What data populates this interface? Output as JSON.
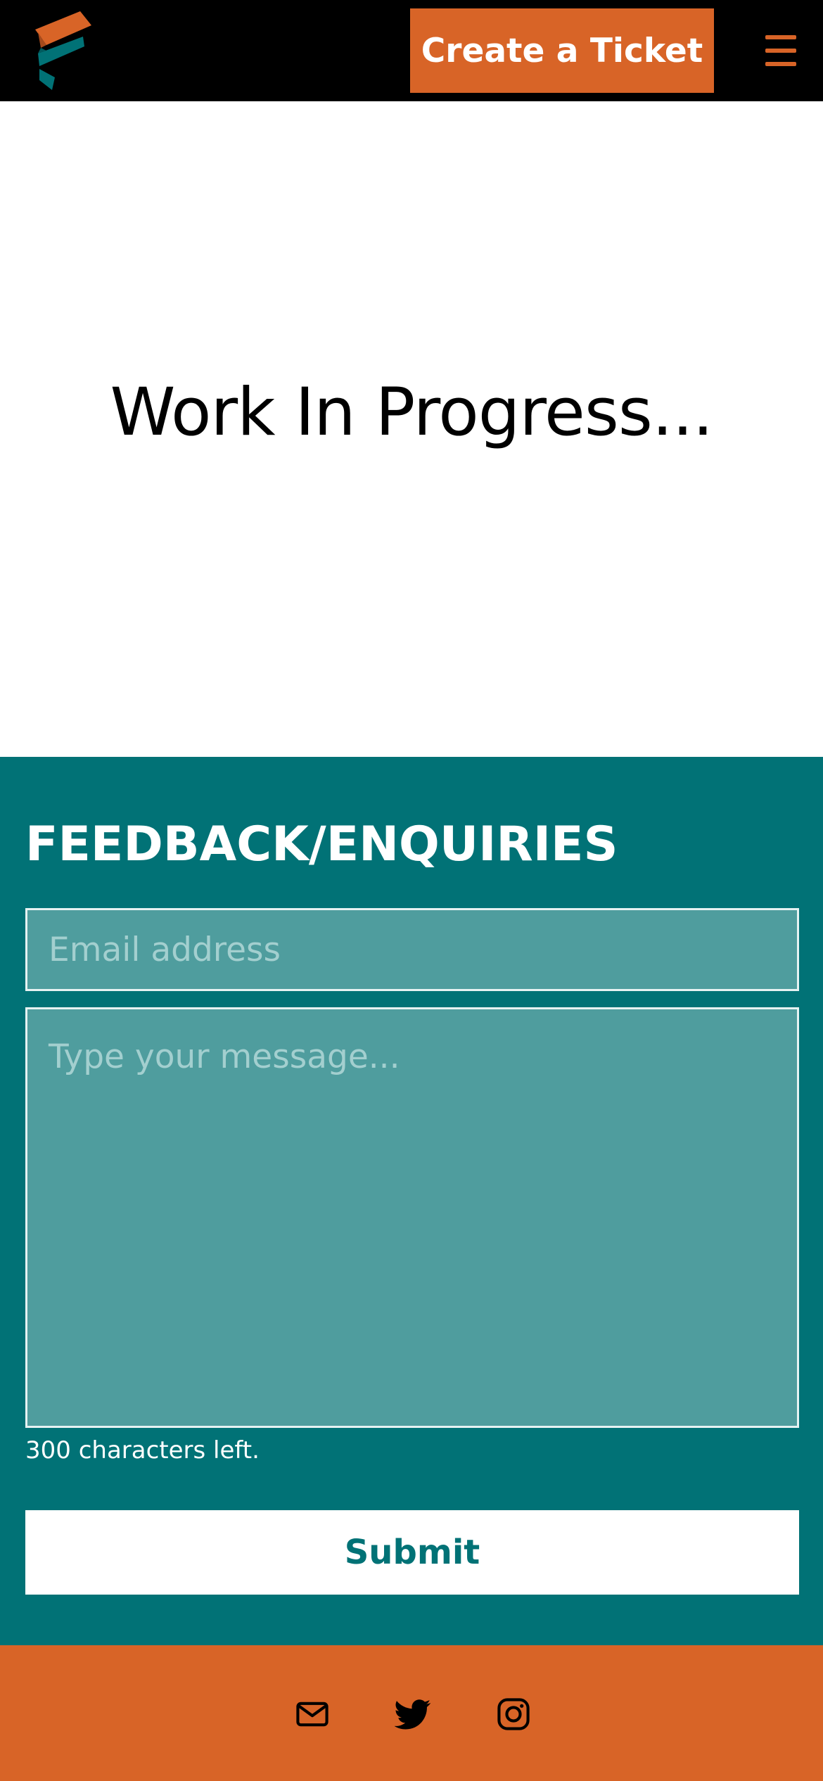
{
  "header": {
    "cta_label": "Create a Ticket",
    "menu_icon": "hamburger-menu-icon",
    "logo_icon": "brand-logo",
    "colors": {
      "background": "#000000",
      "accent": "#d86427",
      "logo_teal": "#017276"
    }
  },
  "hero": {
    "title": "Work In Progress..."
  },
  "feedback": {
    "title": "FEEDBACK/ENQUIRIES",
    "email_value": "",
    "email_placeholder": "Email address",
    "message_value": "",
    "message_placeholder": "Type your message...",
    "char_counter": "300 characters left.",
    "submit_label": "Submit",
    "colors": {
      "background": "#017276",
      "field_background": "#4f9d9e",
      "button_background": "#ffffff"
    }
  },
  "footer": {
    "social_icons": [
      "email-icon",
      "twitter-icon",
      "instagram-icon"
    ],
    "colors": {
      "background": "#d86427",
      "icon": "#000000"
    }
  }
}
